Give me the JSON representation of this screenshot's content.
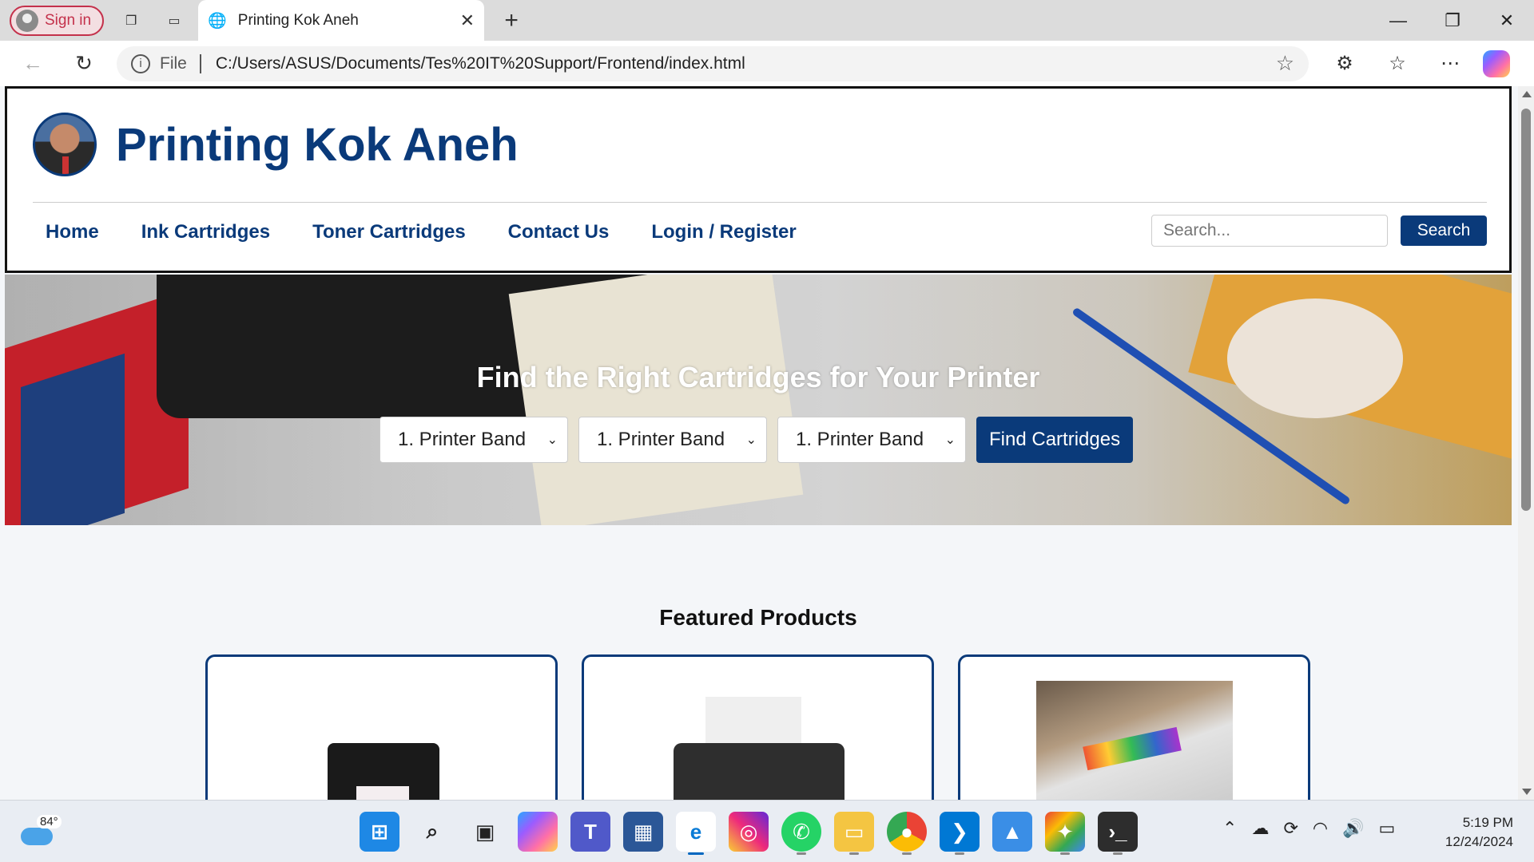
{
  "browser": {
    "signin_label": "Sign in",
    "tab_title": "Printing Kok Aneh",
    "url_scheme_label": "File",
    "url": "C:/Users/ASUS/Documents/Tes%20IT%20Support/Frontend/index.html"
  },
  "site": {
    "brand": "Printing Kok Aneh",
    "nav": [
      "Home",
      "Ink Cartridges",
      "Toner Cartridges",
      "Contact Us",
      "Login / Register"
    ],
    "search_placeholder": "Search...",
    "search_button": "Search"
  },
  "hero": {
    "heading": "Find the Right Cartridges for Your Printer",
    "selects": [
      "1. Printer Band",
      "1. Printer Band",
      "1. Printer Band"
    ],
    "find_button": "Find Cartridges"
  },
  "featured": {
    "title": "Featured Products",
    "cards": [
      "ink-printer",
      "dot-matrix-printer",
      "laser-printer"
    ]
  },
  "taskbar": {
    "temperature": "84°",
    "time": "5:19 PM",
    "date": "12/24/2024",
    "apps": [
      "start",
      "search",
      "task-view",
      "copilot",
      "teams",
      "store",
      "edge",
      "instagram",
      "whatsapp",
      "file-explorer",
      "chrome",
      "vscode",
      "photos",
      "gemini",
      "terminal"
    ]
  },
  "colors": {
    "brand_blue": "#0a3a7a",
    "signin_red": "#c4314b"
  }
}
